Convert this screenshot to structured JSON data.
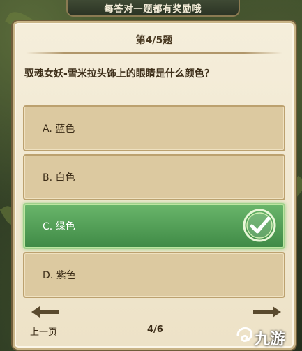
{
  "banner": {
    "text": "每答对一题都有奖励哦"
  },
  "quiz": {
    "counter": "第4/5题",
    "question": "驭魂女妖-雪米拉头饰上的眼睛是什么颜色？",
    "options": [
      {
        "label": "A. 蓝色",
        "state": "normal"
      },
      {
        "label": "B. 白色",
        "state": "normal"
      },
      {
        "label": "C. 绿色",
        "state": "correct"
      },
      {
        "label": "D. 紫色",
        "state": "normal"
      }
    ],
    "correct_color": "#4f9d53"
  },
  "nav": {
    "prev_label": "上一页",
    "page": "4/6"
  },
  "watermark": {
    "text": "九游"
  }
}
